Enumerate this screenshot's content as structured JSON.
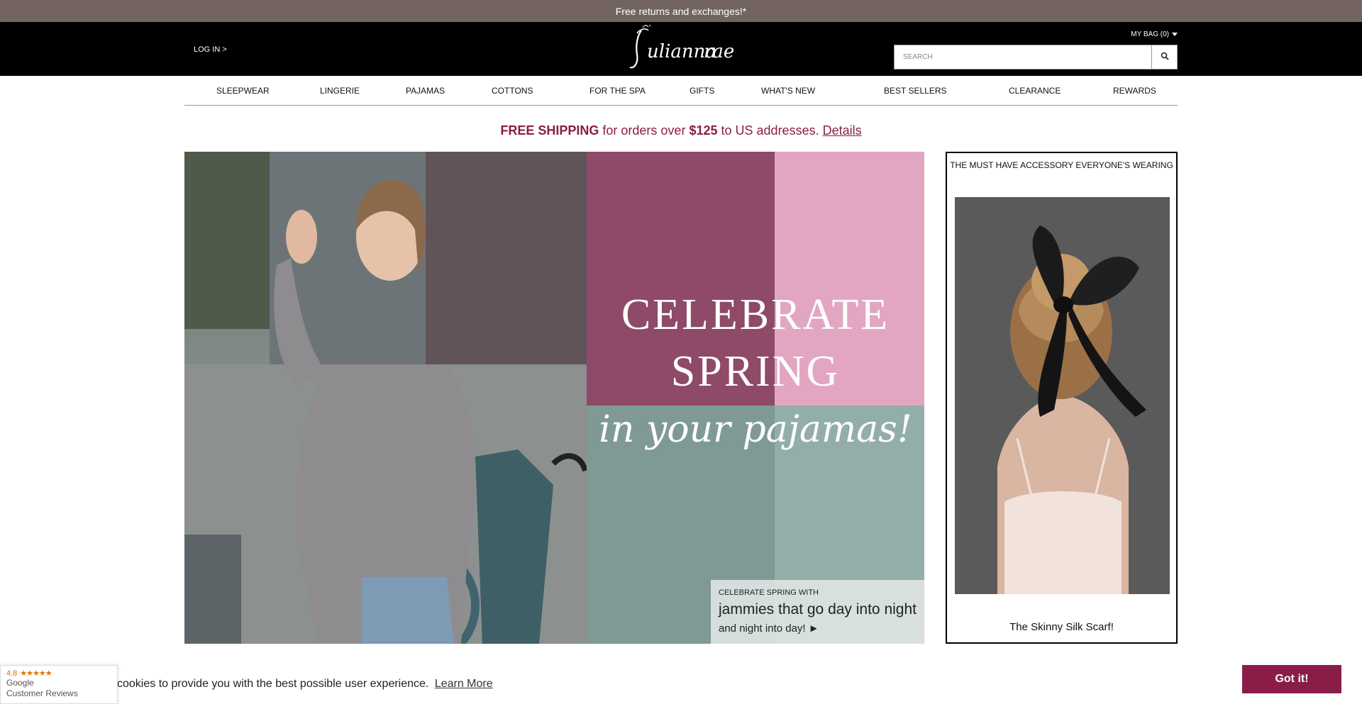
{
  "promo": {
    "text": "Free returns and exchanges!*"
  },
  "header": {
    "login": "LOG IN >",
    "bag": "MY BAG (0)",
    "search_placeholder": "SEARCH"
  },
  "nav": {
    "items": [
      "SLEEPWEAR",
      "LINGERIE",
      "PAJAMAS",
      "COTTONS",
      "FOR THE SPA",
      "GIFTS",
      "WHAT'S NEW",
      "BEST SELLERS",
      "CLEARANCE",
      "REWARDS"
    ]
  },
  "shipping": {
    "bold1": "FREE SHIPPING",
    "text1": "for orders over",
    "bold2": "$125",
    "text2": "to US addresses.",
    "link": "Details"
  },
  "hero": {
    "headline_line1": "CELEBRATE",
    "headline_line2": "SPRING",
    "script": "in your pajamas!",
    "caption_small": "CELEBRATE SPRING WITH",
    "caption_large": "jammies that go day into night",
    "caption_link": "and night into day! ►"
  },
  "side_card": {
    "title": "THE MUST HAVE ACCESSORY EVERYONE'S WEARING",
    "caption": "The Skinny Silk Scarf!"
  },
  "cookie": {
    "text": "cookies to provide you with the best possible user experience.",
    "learn_more": "Learn More",
    "accept": "Got it!"
  },
  "google_badge": {
    "rating": "4.8",
    "stars": "★★★★★",
    "line1": "Google",
    "line2": "Customer Reviews"
  },
  "colors": {
    "promo_bg": "#746461",
    "accent": "#8a1d48",
    "header_bg": "#000000"
  }
}
